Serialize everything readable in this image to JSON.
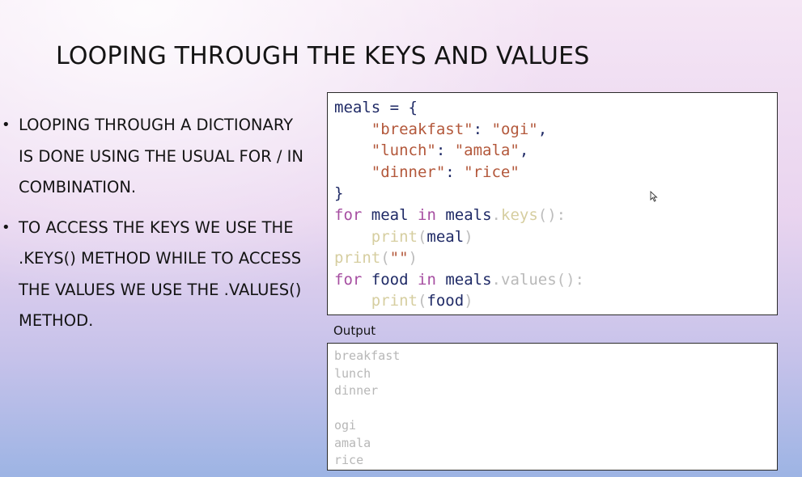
{
  "slide": {
    "title": "LOOPING THROUGH THE KEYS AND VALUES",
    "bullets": [
      "Looping through a dictionary is done using the usual for / in combination.",
      "To access the keys we use the .keys() method while to access the values we use the .values() method."
    ],
    "bullet_glyph": "•"
  },
  "code": {
    "l1": {
      "a": "meals = {"
    },
    "l2": {
      "indent": "    ",
      "key": "\"breakfast\"",
      "sep": ": ",
      "val": "\"ogi\"",
      "end": ","
    },
    "l3": {
      "indent": "    ",
      "key": "\"lunch\"",
      "sep": ": ",
      "val": "\"amala\"",
      "end": ","
    },
    "l4": {
      "indent": "    ",
      "key": "\"dinner\"",
      "sep": ": ",
      "val": "\"rice\""
    },
    "l5": {
      "a": "}"
    },
    "l6": {
      "kw1": "for",
      "var1": "meal",
      "kw2": "in",
      "obj": "meals",
      "dot": ".",
      "fn": "keys",
      "paren": "():"
    },
    "l7": {
      "indent": "    ",
      "fn": "print",
      "open": "(",
      "arg": "meal",
      "close": ")"
    },
    "l8": {
      "fn": "print",
      "open": "(",
      "str": "\"\"",
      "close": ")"
    },
    "l9": {
      "kw1": "for",
      "var1": "food",
      "kw2": "in",
      "obj": "meals",
      "dot": ".",
      "fn": "values",
      "paren": "():"
    },
    "l10": {
      "indent": "    ",
      "fn": "print",
      "open": "(",
      "arg": "food",
      "close": ")"
    }
  },
  "output": {
    "label": "Output",
    "lines": [
      "breakfast",
      "lunch",
      "dinner",
      "",
      "ogi",
      "amala",
      "rice"
    ]
  },
  "colors": {
    "keyword": "#a64ea1",
    "string": "#b3583b",
    "identifier": "#1f2a66",
    "method": "#d6cea0",
    "output_text": "#b7b7b7"
  },
  "icons": {
    "pointer": "mouse-pointer-icon"
  }
}
